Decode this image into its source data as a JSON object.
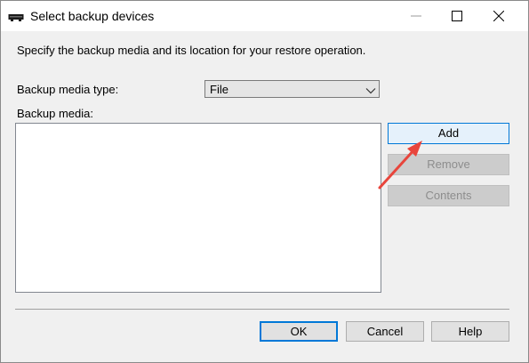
{
  "window": {
    "title": "Select backup devices",
    "icon": "tape-drive-icon",
    "controls": [
      "minimize-icon",
      "maximize-icon",
      "close-icon"
    ]
  },
  "description": "Specify the backup media and its location for your restore operation.",
  "media_type": {
    "label": "Backup media type:",
    "selected": "File"
  },
  "backup_media": {
    "label": "Backup media:",
    "items": []
  },
  "side_buttons": {
    "add": "Add",
    "remove": "Remove",
    "contents": "Contents"
  },
  "footer_buttons": {
    "ok": "OK",
    "cancel": "Cancel",
    "help": "Help"
  },
  "colors": {
    "accent": "#0078d7",
    "annotation_arrow": "#e8453c",
    "dialog_background": "#f0f0f0"
  }
}
